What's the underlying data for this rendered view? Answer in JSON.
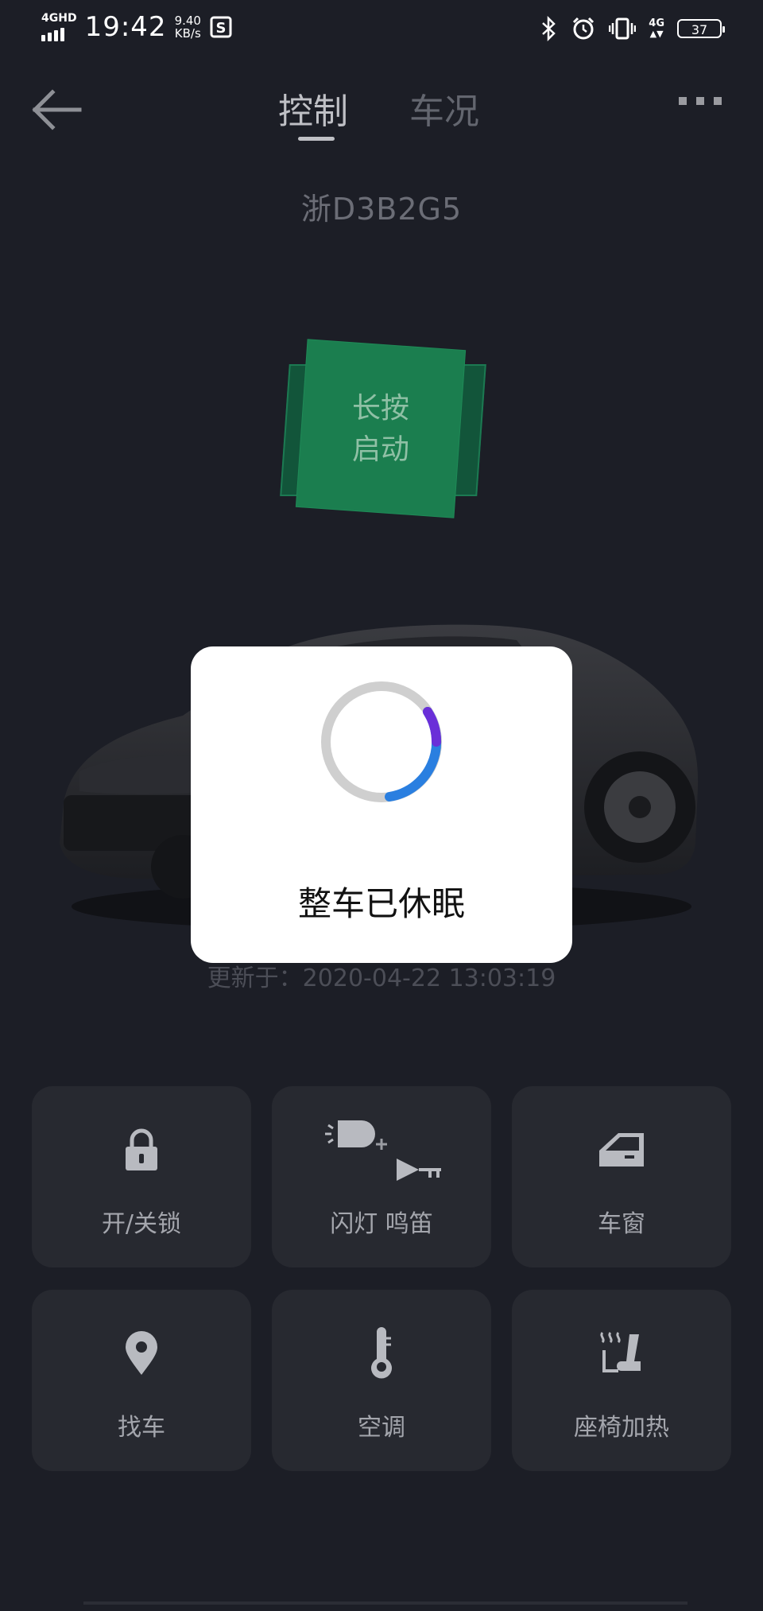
{
  "status_bar": {
    "network": "4GHD",
    "time": "19:42",
    "speed_value": "9.40",
    "speed_unit": "KB/s",
    "network_right": "4G",
    "battery": "37"
  },
  "nav": {
    "tab_control": "控制",
    "tab_status": "车况"
  },
  "vehicle": {
    "plate": "浙D3B2G5"
  },
  "start_button": {
    "line1": "长按",
    "line2": "启动"
  },
  "update_time": "更新于：2020-04-22 13:03:19",
  "modal": {
    "message": "整车已休眠",
    "spinner_progress": 0.3
  },
  "controls": [
    {
      "label": "开/关锁",
      "icon": "lock-icon"
    },
    {
      "label": "闪灯 鸣笛",
      "icon": "flash-horn-icon"
    },
    {
      "label": "车窗",
      "icon": "car-window-icon"
    },
    {
      "label": "找车",
      "icon": "location-pin-icon"
    },
    {
      "label": "空调",
      "icon": "thermometer-icon"
    },
    {
      "label": "座椅加热",
      "icon": "seat-heat-icon"
    }
  ],
  "colors": {
    "background": "#1c1e26",
    "start_green": "#1b7e4f",
    "tile": "#272930",
    "spinner_blue": "#2a7fe0",
    "spinner_purple": "#6a2fd8"
  }
}
